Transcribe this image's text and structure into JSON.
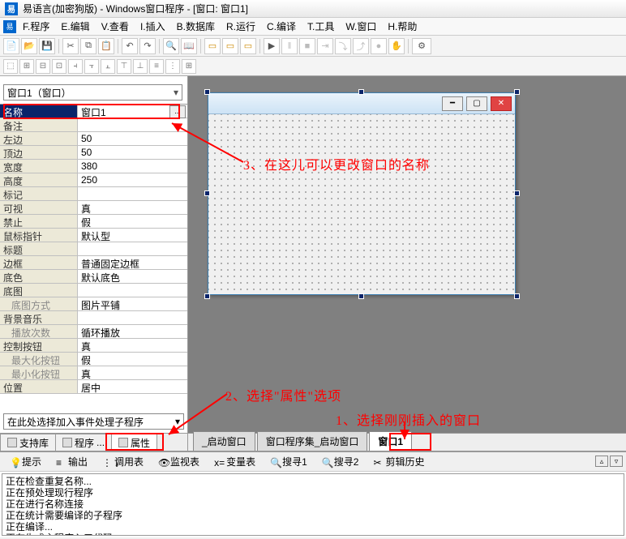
{
  "title": "易语言(加密狗版) - Windows窗口程序 - [窗口: 窗口1]",
  "menu": [
    "F.程序",
    "E.编辑",
    "V.查看",
    "I.插入",
    "B.数据库",
    "R.运行",
    "C.编译",
    "T.工具",
    "W.窗口",
    "H.帮助"
  ],
  "combo": "窗口1（窗口）",
  "props": [
    {
      "k": "名称",
      "v": "窗口1",
      "sel": true
    },
    {
      "k": "备注",
      "v": ""
    },
    {
      "k": "左边",
      "v": "50"
    },
    {
      "k": "顶边",
      "v": "50"
    },
    {
      "k": "宽度",
      "v": "380"
    },
    {
      "k": "高度",
      "v": "250"
    },
    {
      "k": "标记",
      "v": ""
    },
    {
      "k": "可视",
      "v": "真"
    },
    {
      "k": "禁止",
      "v": "假"
    },
    {
      "k": "鼠标指针",
      "v": "默认型"
    },
    {
      "k": "标题",
      "v": ""
    },
    {
      "k": "边框",
      "v": "普通固定边框"
    },
    {
      "k": "底色",
      "v": "默认底色"
    },
    {
      "k": "底图",
      "v": ""
    },
    {
      "k": "底图方式",
      "v": "图片平铺",
      "sub": true
    },
    {
      "k": "背景音乐",
      "v": ""
    },
    {
      "k": "播放次数",
      "v": "循环播放",
      "sub": true
    },
    {
      "k": "控制按钮",
      "v": "真"
    },
    {
      "k": "最大化按钮",
      "v": "假",
      "sub": true
    },
    {
      "k": "最小化按钮",
      "v": "真",
      "sub": true
    },
    {
      "k": "位置",
      "v": "居中"
    }
  ],
  "event_sel": "在此处选择加入事件处理子程序",
  "lefttabs": [
    "支持库",
    "程序",
    "属性"
  ],
  "bottomtabs": [
    "_启动窗口",
    "窗口程序集_启动窗口",
    "窗口1"
  ],
  "panel2tabs": [
    "提示",
    "输出",
    "调用表",
    "监视表",
    "变量表",
    "搜寻1",
    "搜寻2",
    "剪辑历史"
  ],
  "logs": [
    "正在检查重复名称...",
    "正在预处理现行程序",
    "正在进行名称连接",
    "正在统计需要编译的子程序",
    "正在编译...",
    "正在生成主程序入口代码"
  ],
  "annot1": "1、选择刚刚插入的窗口",
  "annot2": "2、选择\"属性\"选项",
  "annot3": "3、在这儿可以更改窗口的名称"
}
